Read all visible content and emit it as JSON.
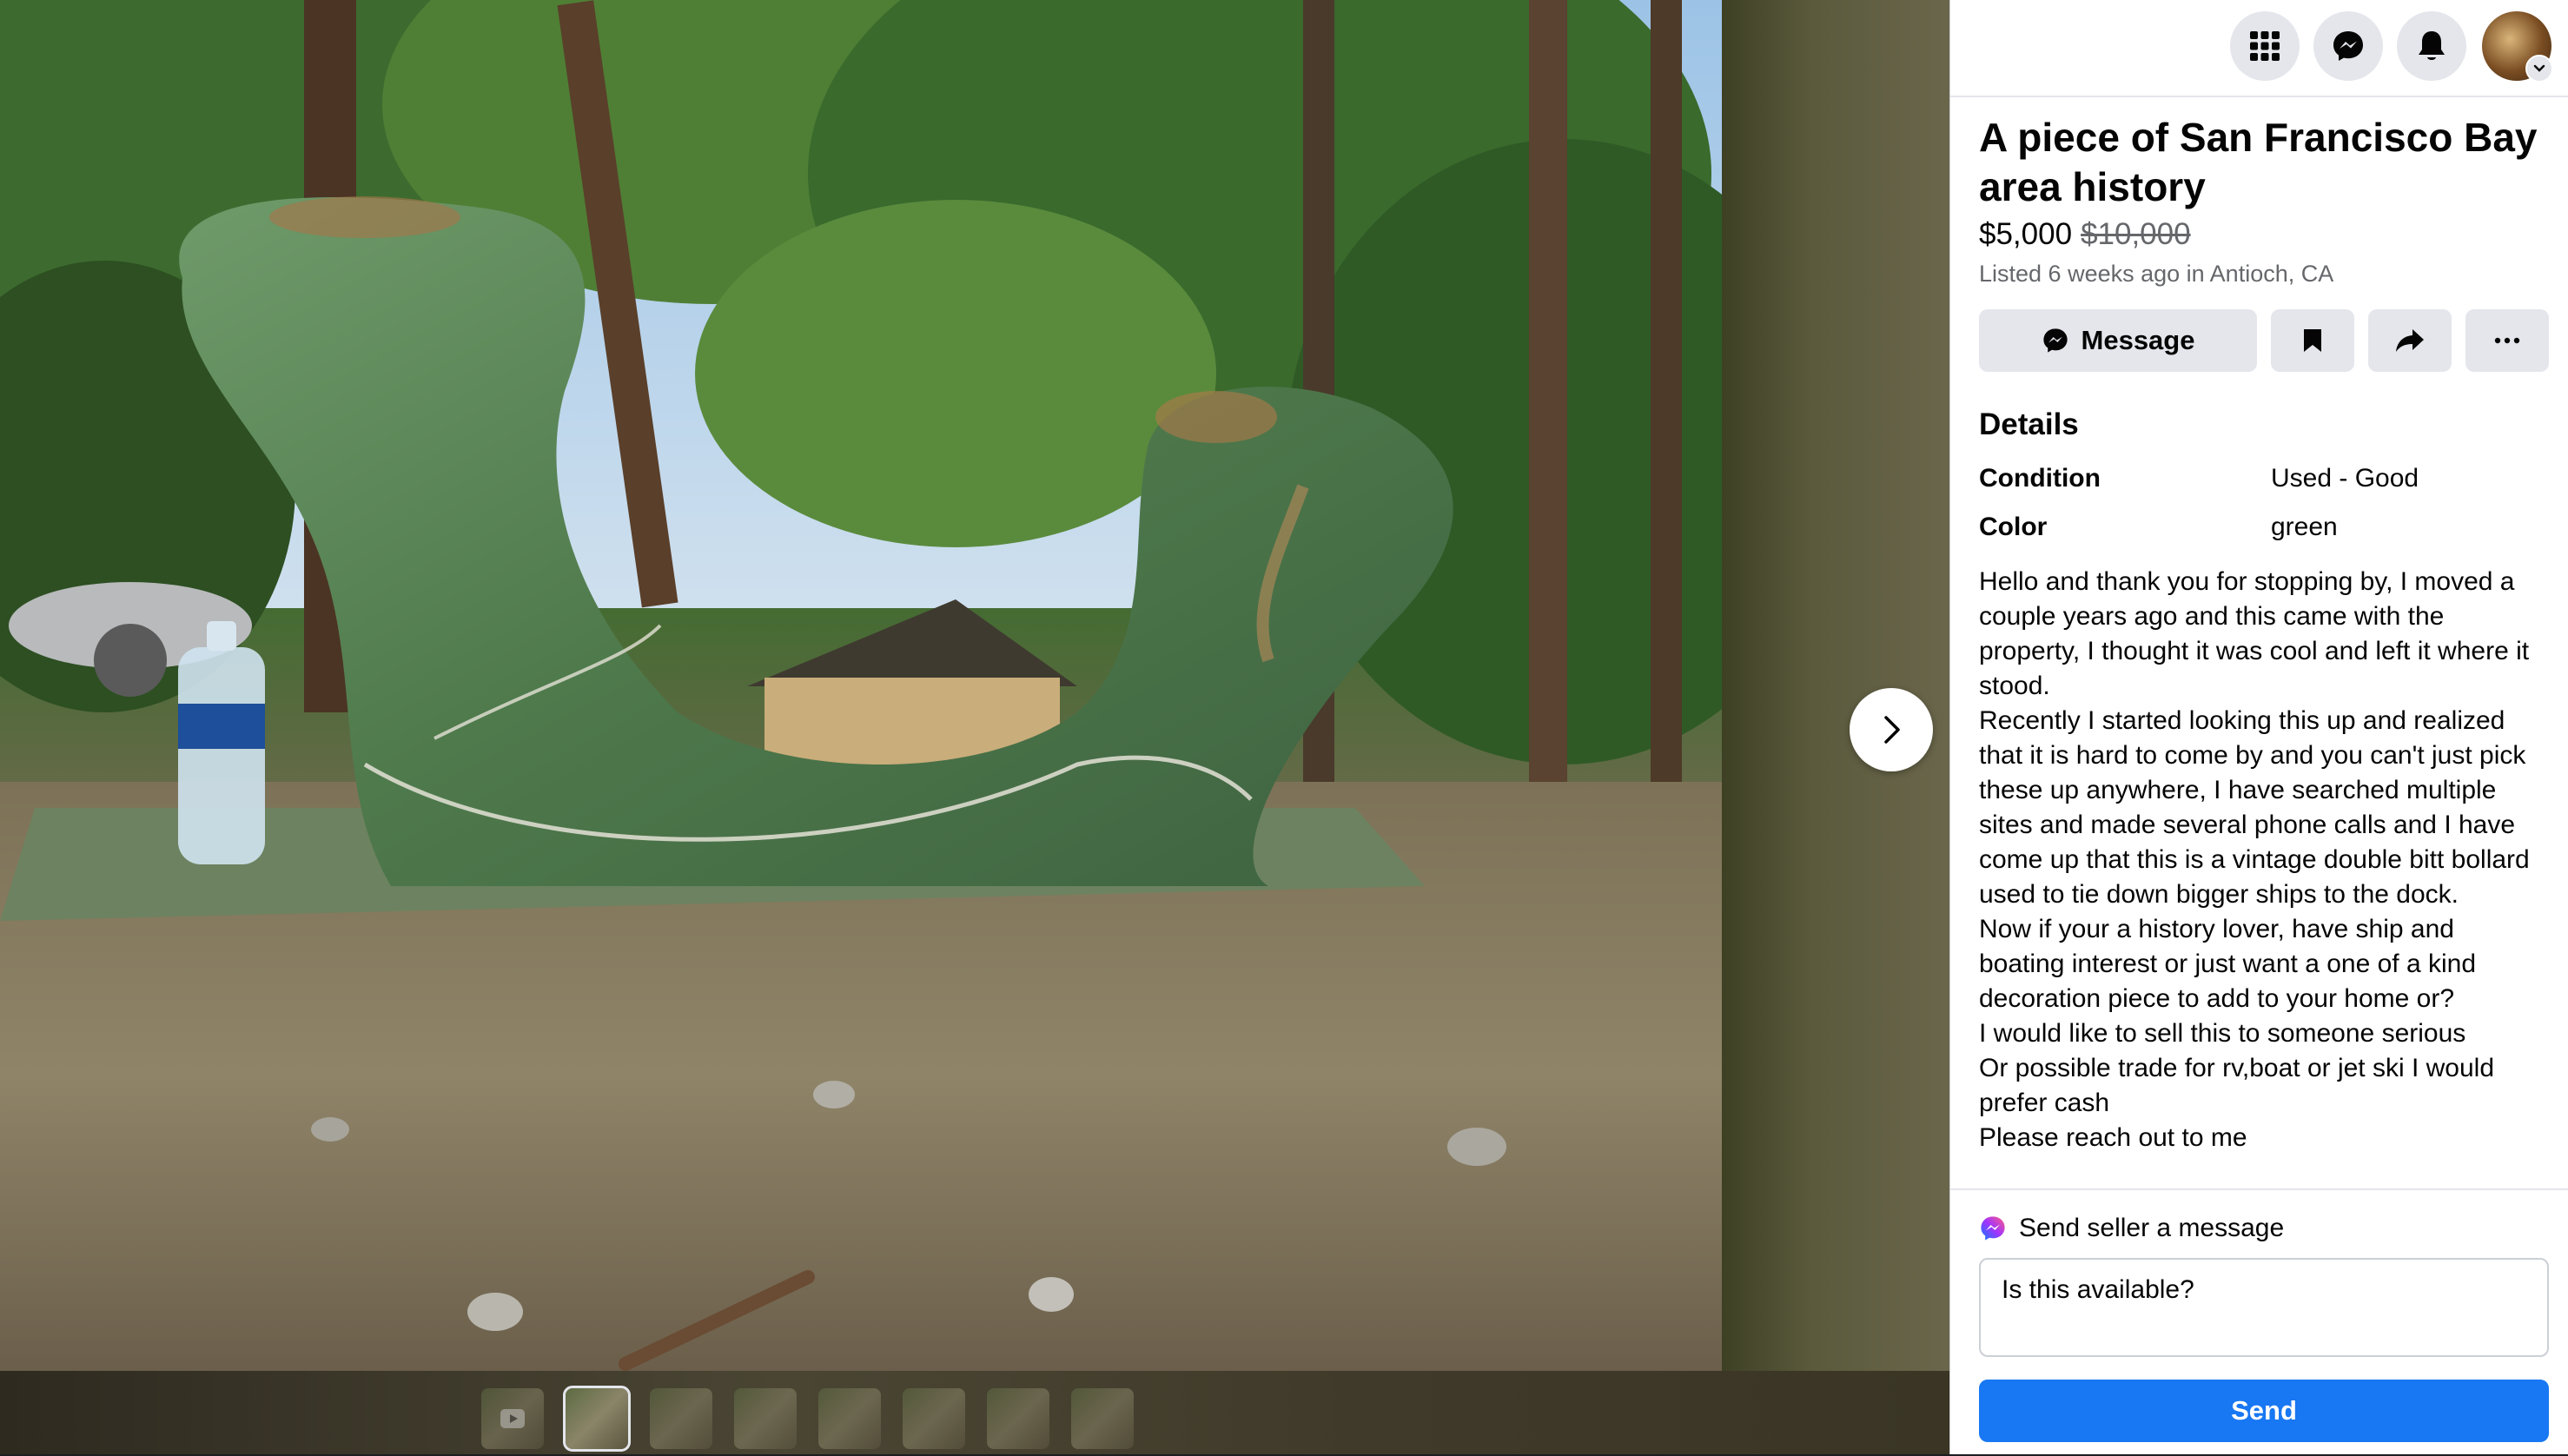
{
  "listing": {
    "title": "A piece of San Francisco Bay area history",
    "price": "$5,000",
    "original_price": "$10,000",
    "listed": "Listed 6 weeks ago in Antioch, CA"
  },
  "actions": {
    "message_label": "Message",
    "save_icon": "bookmark-icon",
    "share_icon": "share-icon",
    "more_icon": "more-icon"
  },
  "details": {
    "heading": "Details",
    "rows": [
      {
        "label": "Condition",
        "value": "Used - Good"
      },
      {
        "label": "Color",
        "value": "green"
      }
    ],
    "description": [
      "Hello and thank you for stopping by, I moved a couple years ago and this came with the property, I thought it was cool and left it where it stood.",
      "Recently I started looking this up and realized that it is hard to come by and you can't just pick these up anywhere, I have searched multiple sites and made several phone calls and I have come up that this is a vintage double bitt bollard used to tie down bigger ships to the dock.",
      "Now if your a history lover, have ship and boating interest or just want a one of a kind decoration piece to add to your home or?",
      "I would like to sell this to someone serious",
      "Or possible trade for rv,boat or jet ski I would prefer cash",
      "Please reach out to me"
    ]
  },
  "messaging": {
    "label": "Send seller a message",
    "input_value": "Is this available?",
    "send_label": "Send"
  },
  "topbar": {
    "icons": [
      "menu-grid-icon",
      "messenger-icon",
      "notifications-icon"
    ]
  },
  "gallery": {
    "thumbnail_count": 8,
    "active_index": 1
  },
  "colors": {
    "accent": "#1877f2",
    "button_bg": "#e4e6eb",
    "secondary_text": "#65676b"
  }
}
